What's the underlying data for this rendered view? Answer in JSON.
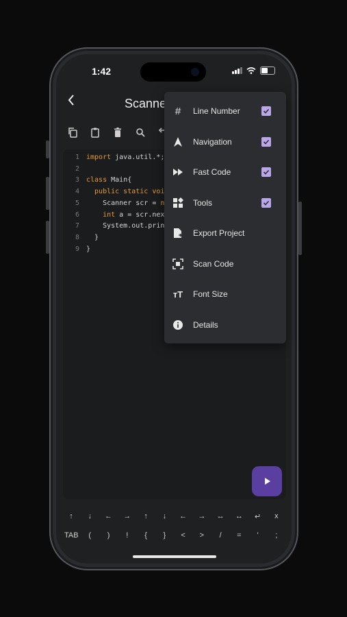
{
  "status": {
    "time": "1:42"
  },
  "header": {
    "title": "Scanne"
  },
  "toolbar": {
    "icons": [
      "copy-icon",
      "clipboard-icon",
      "delete-icon",
      "search-replace-icon",
      "undo-icon"
    ]
  },
  "editor": {
    "lines": [
      {
        "n": "1",
        "parts": [
          {
            "t": "import",
            "k": true
          },
          {
            "t": " java.util.*;",
            "k": false
          }
        ]
      },
      {
        "n": "2",
        "parts": []
      },
      {
        "n": "3",
        "parts": [
          {
            "t": "class",
            "k": true
          },
          {
            "t": " Main{",
            "k": false
          }
        ]
      },
      {
        "n": "4",
        "parts": [
          {
            "t": "  public static void m",
            "k": true
          }
        ]
      },
      {
        "n": "5",
        "parts": [
          {
            "t": "    Scanner scr = ",
            "k": false
          },
          {
            "t": "new",
            "k": true
          }
        ]
      },
      {
        "n": "6",
        "parts": [
          {
            "t": "    int",
            "k": true
          },
          {
            "t": " a = scr.nextInt",
            "k": false
          }
        ]
      },
      {
        "n": "7",
        "parts": [
          {
            "t": "    System.out.print(a",
            "k": false
          }
        ]
      },
      {
        "n": "8",
        "parts": [
          {
            "t": "  }",
            "k": false
          }
        ]
      },
      {
        "n": "9",
        "parts": [
          {
            "t": "}",
            "k": false
          }
        ]
      }
    ]
  },
  "keyboard": {
    "row1": [
      "↑",
      "↓",
      "←",
      "→",
      "↑",
      "↓",
      "←",
      "→",
      "↔",
      "↔",
      "↵",
      "x"
    ],
    "row2": [
      "TAB",
      "(",
      ")",
      "!",
      "{",
      "}",
      "<",
      ">",
      "/",
      "=",
      "'",
      ";"
    ]
  },
  "menu": {
    "items": [
      {
        "label": "Line Number",
        "icon": "hash-icon",
        "checked": true
      },
      {
        "label": "Navigation",
        "icon": "navigation-arrow-icon",
        "checked": true
      },
      {
        "label": "Fast Code",
        "icon": "fast-forward-icon",
        "checked": true
      },
      {
        "label": "Tools",
        "icon": "widgets-icon",
        "checked": true
      },
      {
        "label": "Export Project",
        "icon": "file-export-icon",
        "checked": false
      },
      {
        "label": "Scan Code",
        "icon": "scan-frame-icon",
        "checked": false
      },
      {
        "label": "Font Size",
        "icon": "font-size-icon",
        "checked": false
      },
      {
        "label": "Details",
        "icon": "info-icon",
        "checked": false
      }
    ]
  },
  "colors": {
    "accent": "#5b3fa0",
    "check": "#b9a7ea",
    "keyword": "#e59b3c"
  }
}
